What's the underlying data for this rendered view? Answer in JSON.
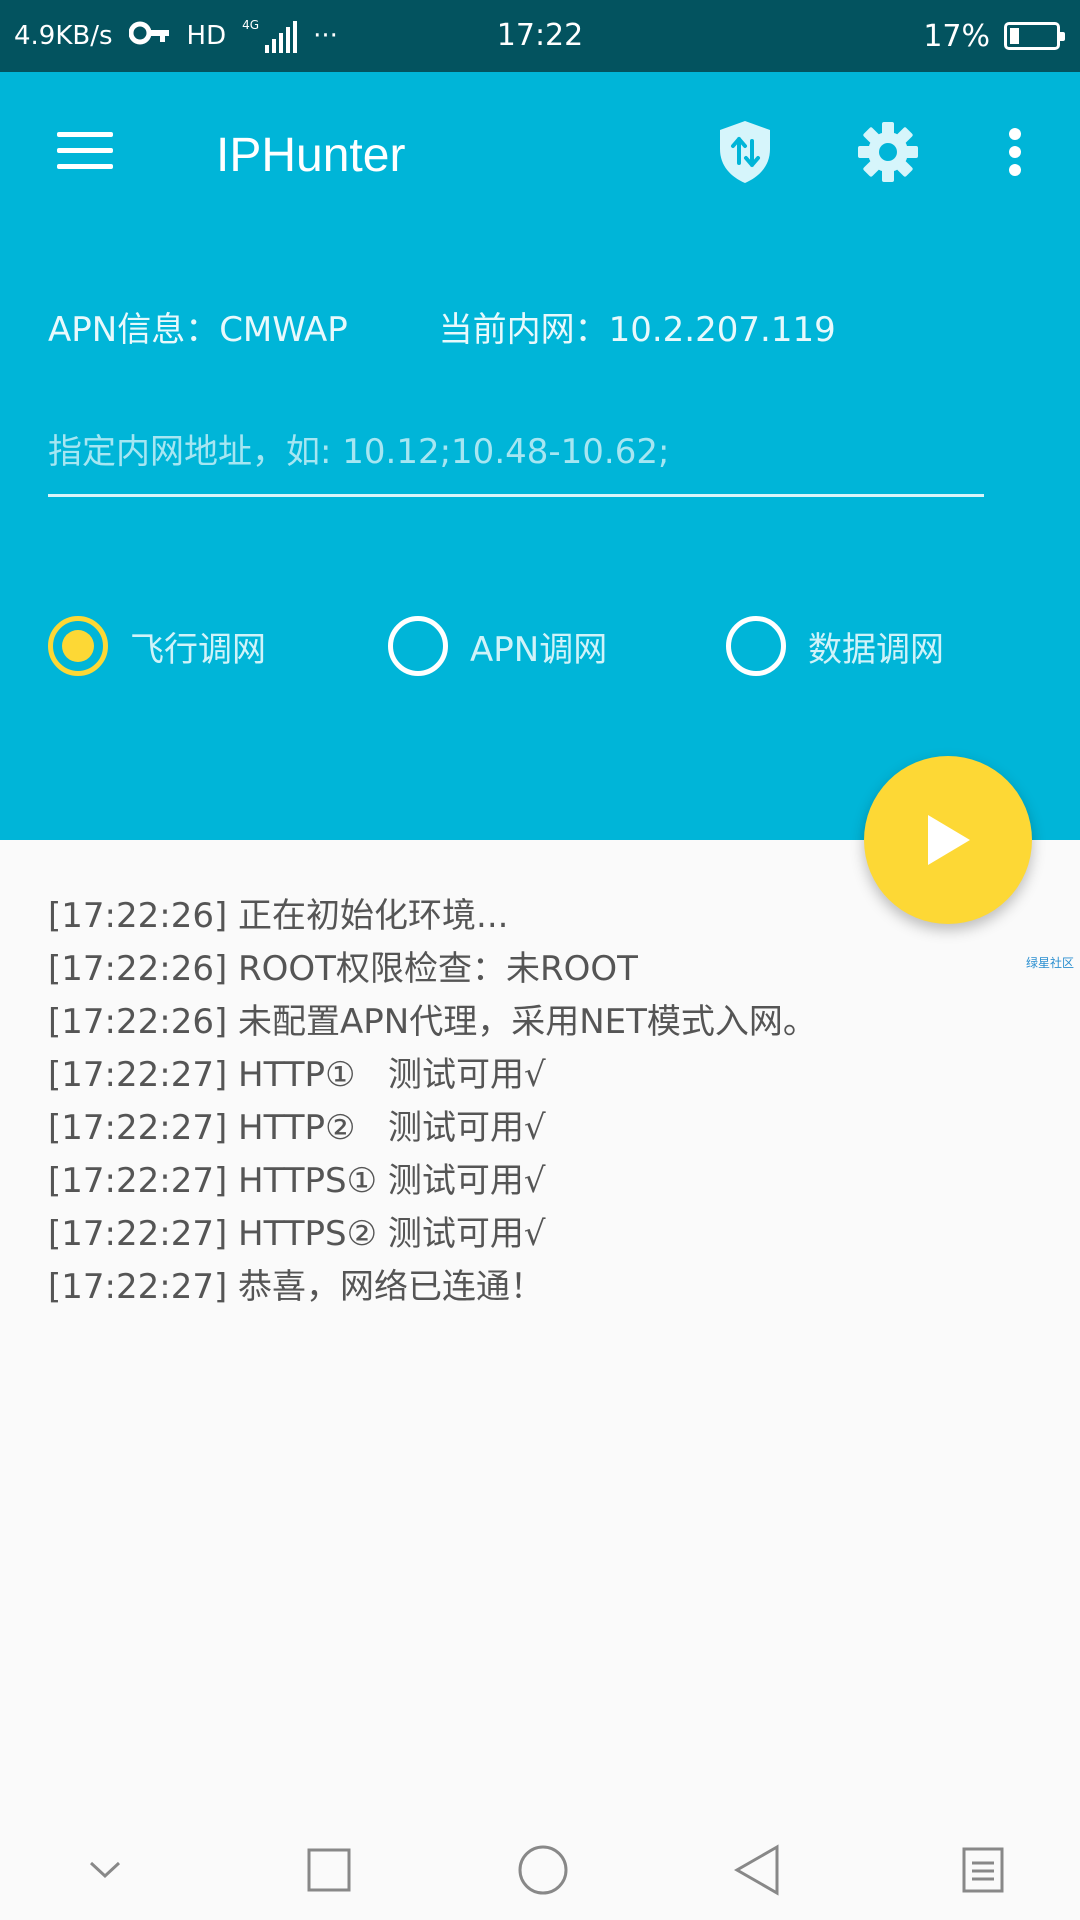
{
  "status_bar": {
    "net_speed": "4.9KB/s",
    "hd": "HD",
    "network_type": "4G",
    "more": "···",
    "time": "17:22",
    "battery": "17%",
    "icons": [
      "vpn-key-icon",
      "signal-icon",
      "battery-icon"
    ]
  },
  "toolbar": {
    "title": "IPHunter",
    "icons": [
      "menu-icon",
      "shield-icon",
      "settings-gear-icon",
      "more-vert-icon"
    ]
  },
  "info": {
    "apn_label": "APN信息：CMWAP",
    "ip_label": "当前内网：10.2.207.119"
  },
  "ip_filter": {
    "value": "",
    "placeholder": "指定内网地址，如: 10.12;10.48-10.62;"
  },
  "modes": {
    "selected": "飞行调网",
    "options": [
      "飞行调网",
      "APN调网",
      "数据调网"
    ]
  },
  "fab": {
    "icon": "play-icon"
  },
  "log": [
    "[17:22:26] 正在初始化环境...",
    "[17:22:26] ROOT权限检查：未ROOT",
    "[17:22:26] 未配置APN代理，采用NET模式入网。",
    "[17:22:27] HTTP①   测试可用√",
    "[17:22:27] HTTP②   测试可用√",
    "[17:22:27] HTTPS① 测试可用√",
    "[17:22:27] HTTPS② 测试可用√",
    "[17:22:27] 恭喜，网络已连通！"
  ],
  "watermark": "绿星社区",
  "nav_bar": {
    "icons": [
      "chevron-down-icon",
      "square-icon",
      "circle-home-icon",
      "triangle-back-icon",
      "list-menu-icon"
    ]
  },
  "colors": {
    "status_bar": "#03535f",
    "primary": "#00b5d8",
    "accent": "#fdd835",
    "background": "#fafafa",
    "log_text": "#555555"
  }
}
